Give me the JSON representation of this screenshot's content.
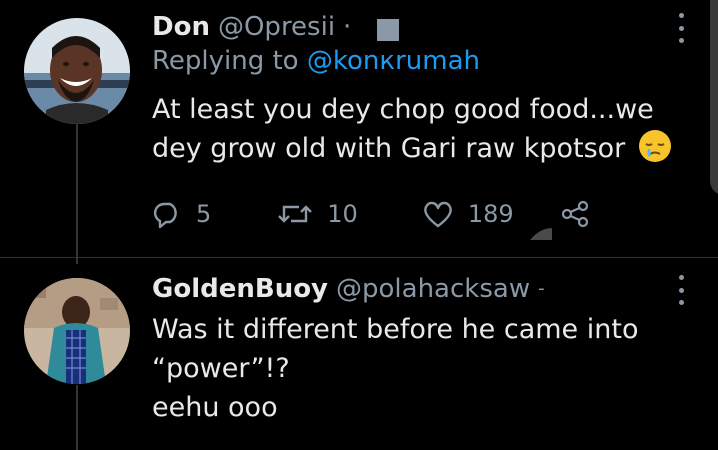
{
  "tweet1": {
    "name": "Don",
    "handle": "@Opresii",
    "dot": "·",
    "replying_prefix": "Replying to ",
    "replying_mention": "@konкrumah",
    "body_line1": "At least you dey chop good food...we",
    "body_line2": "dey grow old with Gari raw kpotsor",
    "emoji": "sleepy-face-emoji",
    "actions": {
      "replies": "5",
      "retweets": "10",
      "likes": "189"
    }
  },
  "tweet2": {
    "name": "GoldenBuoy",
    "handle": "@polahacksaw",
    "chevron": "-",
    "body_line1": "Was it different before he came into",
    "body_line2": "“power”!?",
    "body_line3": "eehu ooo"
  },
  "icons": {
    "reply": "reply-icon",
    "retweet": "retweet-icon",
    "like": "heart-icon",
    "share": "share-icon",
    "more": "more-options-icon"
  },
  "colors": {
    "background": "#000000",
    "text": "#e7e9ea",
    "secondary": "#8b98a5",
    "link": "#1d9bf0"
  }
}
